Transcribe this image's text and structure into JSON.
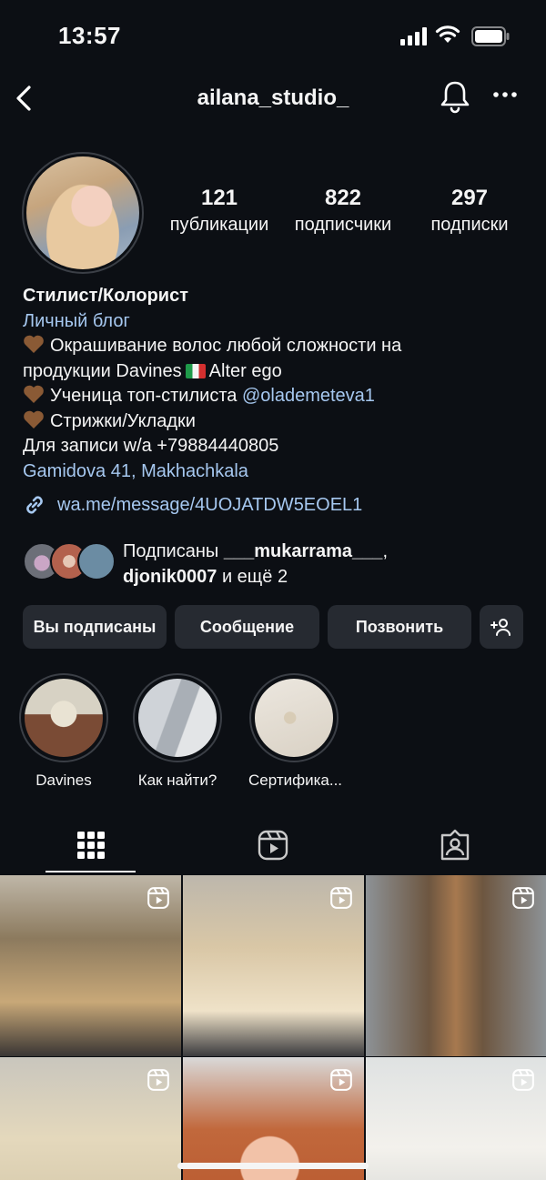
{
  "status_bar": {
    "time": "13:57"
  },
  "nav": {
    "title": "ailana_studio_"
  },
  "profile": {
    "stats": [
      {
        "value": "121",
        "label": "публикации"
      },
      {
        "value": "822",
        "label": "подписчики"
      },
      {
        "value": "297",
        "label": "подписки"
      }
    ],
    "name": "Стилист/Колорист",
    "category": "Личный блог",
    "bio_line1": "Окрашивание волос любой сложности на",
    "bio_line2a": "продукции Davines",
    "bio_line2b": "Alter ego",
    "bio_line3_prefix": "Ученица топ-стилиста",
    "bio_line3_mention": "@olademeteva1",
    "bio_line4": "Стрижки/Укладки",
    "bio_line5": "Для записи w/a +79884440805",
    "address": "Gamidova 41, Makhachkala",
    "link": "wa.me/message/4UOJATDW5EOEL1",
    "followed_prefix": "Подписаны",
    "followed_user1": "___mukarrama___",
    "followed_user2": "djonik0007",
    "followed_suffix": "и ещё 2"
  },
  "buttons": {
    "following": "Вы подписаны",
    "message": "Сообщение",
    "call": "Позвонить"
  },
  "highlights": [
    {
      "label": "Davines"
    },
    {
      "label": "Как найти?"
    },
    {
      "label": "Сертифика..."
    }
  ],
  "icons": {
    "back": "chevron-left-icon",
    "notifications": "bell-icon",
    "more": "more-horizontal-icon",
    "link": "link-icon",
    "add_person": "add-person-icon",
    "grid_tab": "grid-icon",
    "reels_tab": "reels-icon",
    "tagged_tab": "tagged-icon",
    "reel_badge": "reel-icon"
  },
  "colors": {
    "background": "#0c0f14",
    "link": "#a6c8f0",
    "button": "#262a31"
  }
}
